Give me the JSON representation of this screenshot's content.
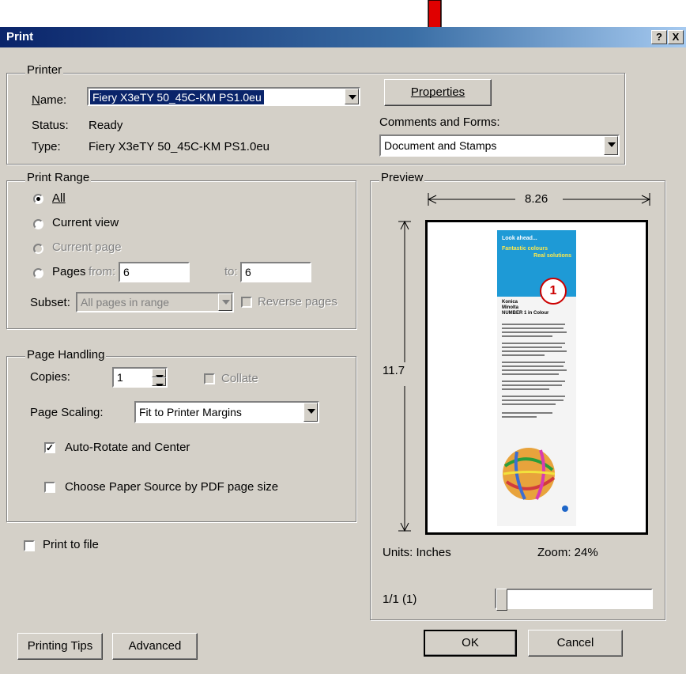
{
  "window": {
    "title": "Print",
    "help_label": "?",
    "close_label": "X"
  },
  "printer": {
    "group_label": "Printer",
    "name_label": "Name:",
    "name_value": "Fiery X3eTY 50_45C-KM PS1.0eu",
    "status_label": "Status:",
    "status_value": "Ready",
    "type_label": "Type:",
    "type_value": "Fiery X3eTY 50_45C-KM PS1.0eu",
    "properties_label": "Properties",
    "comments_label": "Comments and Forms:",
    "comments_value": "Document and Stamps"
  },
  "print_range": {
    "group_label": "Print Range",
    "all_label": "All",
    "current_view_label": "Current view",
    "current_page_label": "Current page",
    "pages_label": "Pages",
    "from_label": "from:",
    "from_value": "6",
    "to_label": "to:",
    "to_value": "6",
    "subset_label": "Subset:",
    "subset_value": "All pages in range",
    "reverse_label": "Reverse pages",
    "selected": "all"
  },
  "page_handling": {
    "group_label": "Page Handling",
    "copies_label": "Copies:",
    "copies_value": "1",
    "collate_label": "Collate",
    "scaling_label": "Page Scaling:",
    "scaling_value": "Fit to Printer Margins",
    "auto_rotate_label": "Auto-Rotate and Center",
    "auto_rotate_checked": true,
    "paper_source_label": "Choose Paper Source by PDF page size",
    "paper_source_checked": false
  },
  "print_to_file": {
    "label": "Print to file",
    "checked": false
  },
  "preview": {
    "group_label": "Preview",
    "width_value": "8.26",
    "height_value": "11.7",
    "units_label": "Units: Inches",
    "zoom_label": "Zoom:  24%",
    "page_counter": "1/1 (1)",
    "slider_position": 0,
    "doc": {
      "heading1": "Look ahead...",
      "heading2": "Fantastic colours",
      "heading3": "Real solutions",
      "body1": "Konica",
      "body2": "Minolta",
      "body3": "NUMBER 1 in Colour"
    }
  },
  "footer": {
    "tips_label": "Printing Tips",
    "advanced_label": "Advanced",
    "ok_label": "OK",
    "cancel_label": "Cancel"
  },
  "annotation": {
    "arrow_color": "#e00000"
  },
  "colors": {
    "title_start": "#0a246a",
    "title_end": "#a6caf0",
    "dialog_bg": "#d4d0c8",
    "doc_blue": "#1e9ad6"
  }
}
